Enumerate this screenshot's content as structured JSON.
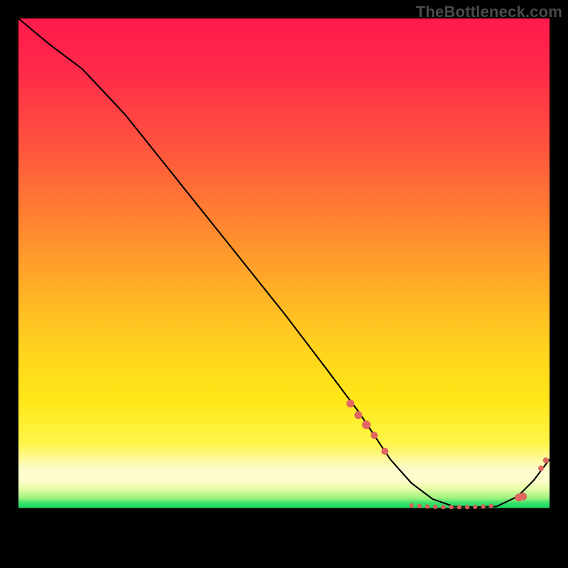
{
  "watermark": "TheBottleneck.com",
  "chart_data": {
    "type": "line",
    "title": "",
    "xlabel": "",
    "ylabel": "",
    "xlim": [
      0,
      100
    ],
    "ylim": [
      0,
      100
    ],
    "grid": false,
    "legend": false,
    "series": [
      {
        "name": "bottleneck-curve",
        "x": [
          0,
          6,
          12,
          20,
          30,
          40,
          50,
          58,
          64,
          70,
          74,
          78,
          82,
          86,
          90,
          94,
          97,
          100
        ],
        "y": [
          100,
          95,
          90.5,
          82,
          69.5,
          57,
          44.5,
          34,
          26,
          17,
          12.5,
          9.5,
          8.1,
          8.0,
          8.1,
          10,
          13,
          17
        ]
      }
    ],
    "markers": {
      "name": "highlight-dots",
      "points": [
        {
          "x": 62.5,
          "y": 27.5,
          "r": 5.5
        },
        {
          "x": 64.0,
          "y": 25.3,
          "r": 5.5
        },
        {
          "x": 65.5,
          "y": 23.5,
          "r": 6.0
        },
        {
          "x": 67.0,
          "y": 21.5,
          "r": 5.0
        },
        {
          "x": 69.0,
          "y": 18.5,
          "r": 5.0
        },
        {
          "x": 74.0,
          "y": 8.3,
          "r": 3.2
        },
        {
          "x": 75.5,
          "y": 8.2,
          "r": 3.2
        },
        {
          "x": 77.0,
          "y": 8.1,
          "r": 3.2
        },
        {
          "x": 78.5,
          "y": 8.05,
          "r": 3.2
        },
        {
          "x": 80.0,
          "y": 8.0,
          "r": 3.2
        },
        {
          "x": 81.5,
          "y": 8.0,
          "r": 3.2
        },
        {
          "x": 83.0,
          "y": 8.0,
          "r": 3.2
        },
        {
          "x": 84.5,
          "y": 8.0,
          "r": 3.2
        },
        {
          "x": 86.0,
          "y": 8.05,
          "r": 3.2
        },
        {
          "x": 87.5,
          "y": 8.1,
          "r": 3.2
        },
        {
          "x": 89.0,
          "y": 8.2,
          "r": 3.2
        },
        {
          "x": 94.2,
          "y": 9.8,
          "r": 5.5
        },
        {
          "x": 95.0,
          "y": 10.0,
          "r": 5.5
        },
        {
          "x": 98.4,
          "y": 15.3,
          "r": 4.0
        },
        {
          "x": 99.3,
          "y": 16.8,
          "r": 4.0
        }
      ]
    },
    "background_gradient": {
      "top": "#ff1a4d",
      "mid": "#ffd21e",
      "pale_band": "#fdfccc",
      "green_band": "#16d964",
      "bottom": "#000000"
    }
  }
}
